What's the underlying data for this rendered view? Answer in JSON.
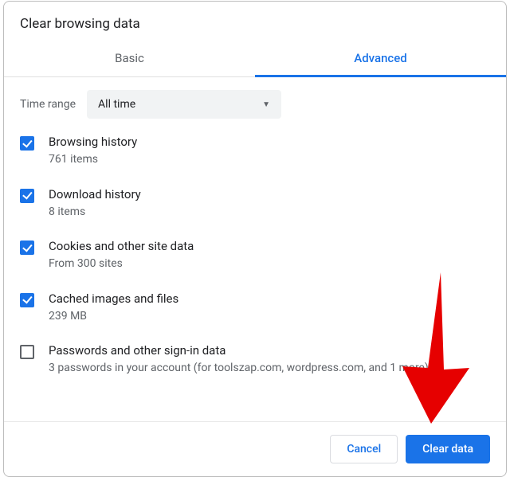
{
  "dialog": {
    "title": "Clear browsing data",
    "tabs": {
      "basic": "Basic",
      "advanced": "Advanced",
      "active": "advanced"
    },
    "time_range": {
      "label": "Time range",
      "value": "All time"
    },
    "items": [
      {
        "label": "Browsing history",
        "sub": "761 items",
        "checked": true
      },
      {
        "label": "Download history",
        "sub": "8 items",
        "checked": true
      },
      {
        "label": "Cookies and other site data",
        "sub": "From 300 sites",
        "checked": true
      },
      {
        "label": "Cached images and files",
        "sub": "239 MB",
        "checked": true
      },
      {
        "label": "Passwords and other sign-in data",
        "sub": "3 passwords in your account (for toolszap.com, wordpress.com, and 1 more)",
        "checked": false
      }
    ],
    "buttons": {
      "cancel": "Cancel",
      "clear": "Clear data"
    }
  }
}
